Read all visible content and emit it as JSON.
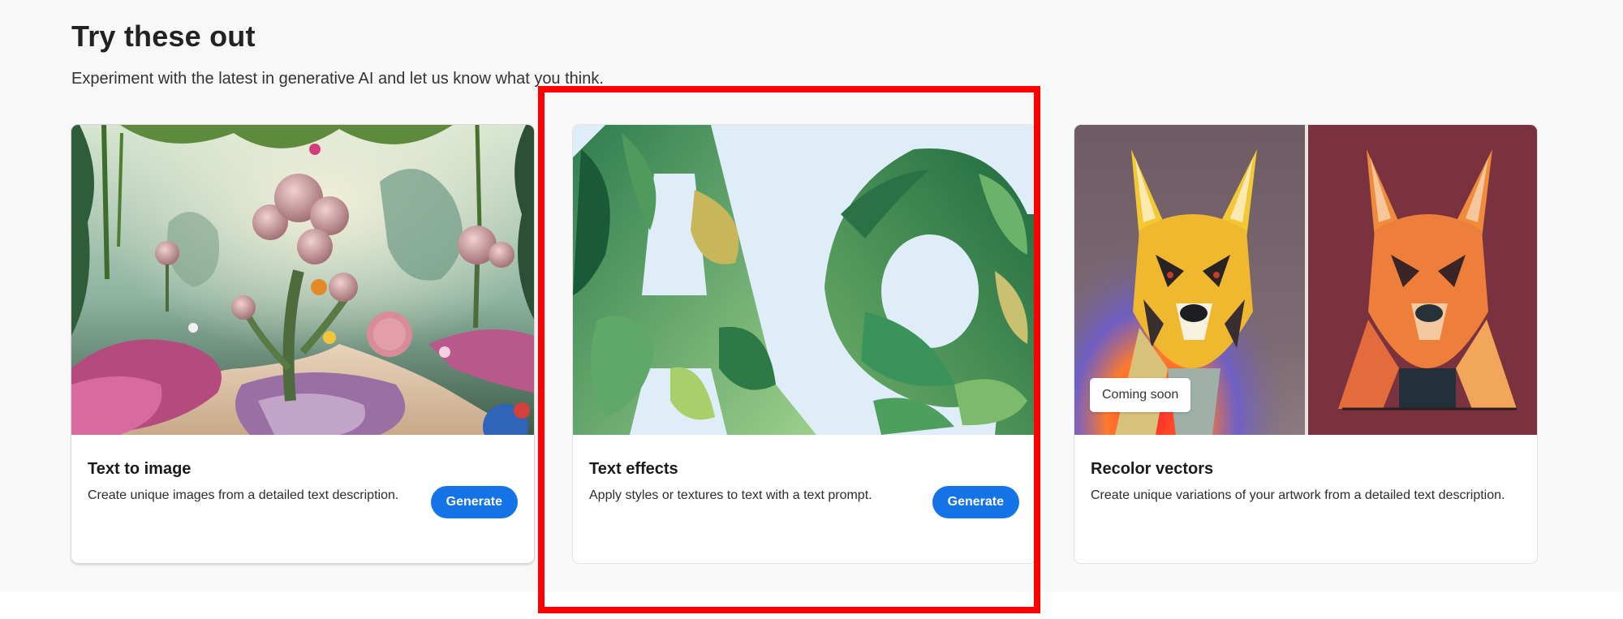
{
  "section": {
    "title": "Try these out",
    "subtitle": "Experiment with the latest in generative AI and let us know what you think."
  },
  "cards": [
    {
      "title": "Text to image",
      "description": "Create unique images from a detailed text description.",
      "button": "Generate",
      "image": "fantasy-garden-illustration"
    },
    {
      "title": "Text effects",
      "description": "Apply styles or textures to text with a text prompt.",
      "button": "Generate",
      "image": "leafy-letters-Ag"
    },
    {
      "title": "Recolor vectors",
      "description": "Create unique variations of your artwork from a detailed text description.",
      "badge": "Coming soon",
      "image": "geometric-dog-vector-variations"
    }
  ],
  "colors": {
    "accent": "#1473e6",
    "highlight": "#ff0000",
    "section_background": "#f8f8f8"
  }
}
